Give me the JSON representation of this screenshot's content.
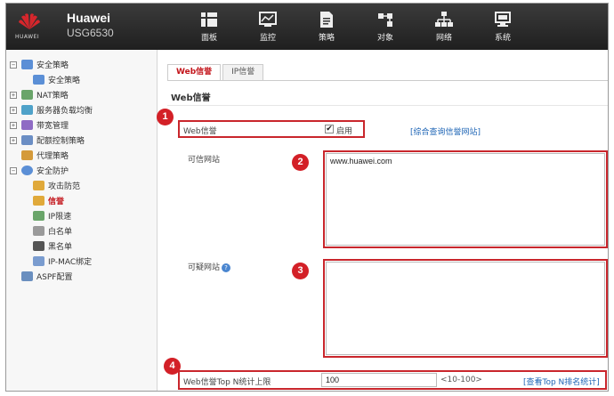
{
  "brand": {
    "name": "Huawei",
    "model": "USG6530",
    "logo_text": "HUAWEI"
  },
  "nav": [
    {
      "label": "面板",
      "icon": "dashboard-icon"
    },
    {
      "label": "监控",
      "icon": "monitor-icon"
    },
    {
      "label": "策略",
      "icon": "policy-icon"
    },
    {
      "label": "对象",
      "icon": "object-icon"
    },
    {
      "label": "网络",
      "icon": "network-icon"
    },
    {
      "label": "系统",
      "icon": "system-icon"
    }
  ],
  "sidebar": {
    "items": [
      {
        "label": "安全策略",
        "level": 0,
        "expander": "−",
        "icon_color": "#5b8fd6"
      },
      {
        "label": "安全策略",
        "level": 1,
        "icon_color": "#5b8fd6"
      },
      {
        "label": "NAT策略",
        "level": 0,
        "expander": "+",
        "icon_color": "#6aa56a"
      },
      {
        "label": "服务器负载均衡",
        "level": 0,
        "expander": "+",
        "icon_color": "#4fa2c9"
      },
      {
        "label": "带宽管理",
        "level": 0,
        "expander": "+",
        "icon_color": "#8f6bc4"
      },
      {
        "label": "配额控制策略",
        "level": 0,
        "expander": "+",
        "icon_color": "#6b8ec4"
      },
      {
        "label": "代理策略",
        "level": 0,
        "icon_color": "#d49a3a"
      },
      {
        "label": "安全防护",
        "level": 0,
        "expander": "−",
        "icon_color": "#5b8fd6"
      },
      {
        "label": "攻击防范",
        "level": 1,
        "icon_color": "#e0a93a"
      },
      {
        "label": "信誉",
        "level": 1,
        "icon_color": "#e0a93a",
        "active": true
      },
      {
        "label": "IP限速",
        "level": 1,
        "icon_color": "#6aa56a"
      },
      {
        "label": "白名单",
        "level": 1,
        "icon_color": "#9a9a9a"
      },
      {
        "label": "黑名单",
        "level": 1,
        "icon_color": "#555555"
      },
      {
        "label": "IP-MAC绑定",
        "level": 1,
        "icon_color": "#7a9ccf"
      },
      {
        "label": "ASPF配置",
        "level": 0,
        "icon_color": "#6a8fbf"
      }
    ]
  },
  "tabs": [
    {
      "label": "Web信誉",
      "active": true
    },
    {
      "label": "IP信誉",
      "active": false
    }
  ],
  "section_title": "Web信誉",
  "form": {
    "web_reputation_label": "Web信誉",
    "enable_label": "启用",
    "enable_checked": "✔",
    "query_link": "[综合查询信誉网站]",
    "trusted_label": "可信网站",
    "trusted_value": "www.huawei.com",
    "suspicious_label": "可疑网站",
    "suspicious_value": "",
    "topn_label": "Web信誉Top N统计上限",
    "topn_value": "100",
    "topn_hint": "<10-100>",
    "topn_link": "[查看Top N排名统计]"
  },
  "badges": [
    "1",
    "2",
    "3",
    "4"
  ],
  "colors": {
    "accent": "#c3151b",
    "highlight_box": "#c9262c",
    "link": "#1d64b5",
    "topbar": "#2b2b2b"
  }
}
